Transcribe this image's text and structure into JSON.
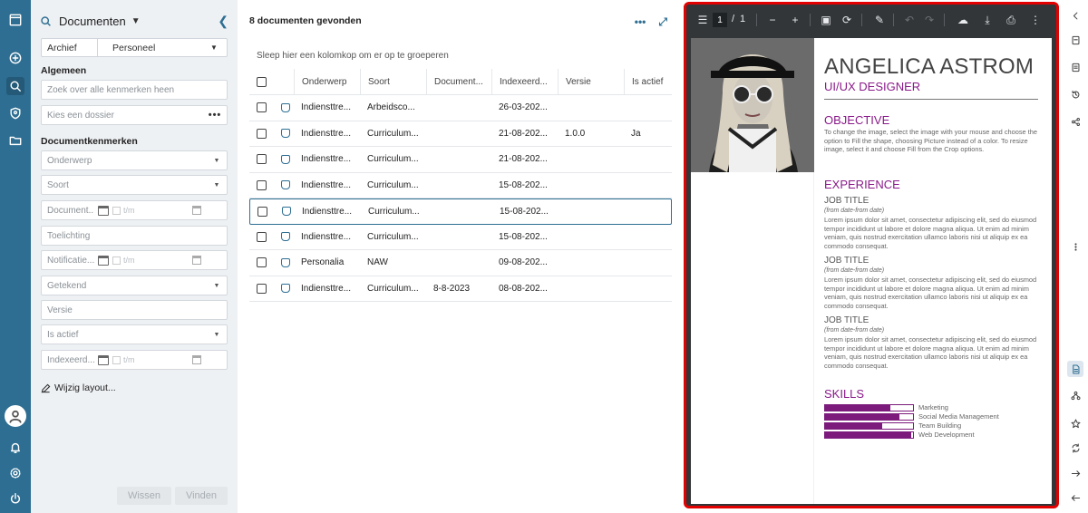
{
  "filters": {
    "title": "Documenten",
    "archive_label": "Archief",
    "archive_value": "Personeel",
    "section_general": "Algemeen",
    "search_placeholder": "Zoek over alle kenmerken heen",
    "dossier_placeholder": "Kies een dossier",
    "section_doc_props": "Documentkenmerken",
    "fields": {
      "onderwerp": "Onderwerp",
      "soort": "Soort",
      "document": "Document...",
      "toelichting": "Toelichting",
      "notificatie": "Notificatie...",
      "getekend": "Getekend",
      "versie": "Versie",
      "is_actief": "Is actief",
      "indexeerd": "Indexeerd..."
    },
    "tm_label": "t/m",
    "layout_link": "Wijzig layout...",
    "clear_button": "Wissen",
    "find_button": "Vinden"
  },
  "results": {
    "count_text": "8 documenten gevonden",
    "group_hint": "Sleep hier een kolomkop om er op te groeperen",
    "columns": [
      "Onderwerp",
      "Soort",
      "Document...",
      "Indexeerd...",
      "Versie",
      "Is actief"
    ],
    "rows": [
      {
        "onderwerp": "Indiensttre...",
        "soort": "Arbeidsco...",
        "document": "",
        "indexeerd": "26-03-202...",
        "versie": "",
        "actief": ""
      },
      {
        "onderwerp": "Indiensttre...",
        "soort": "Curriculum...",
        "document": "",
        "indexeerd": "21-08-202...",
        "versie": "1.0.0",
        "actief": "Ja"
      },
      {
        "onderwerp": "Indiensttre...",
        "soort": "Curriculum...",
        "document": "",
        "indexeerd": "21-08-202...",
        "versie": "",
        "actief": ""
      },
      {
        "onderwerp": "Indiensttre...",
        "soort": "Curriculum...",
        "document": "",
        "indexeerd": "15-08-202...",
        "versie": "",
        "actief": ""
      },
      {
        "onderwerp": "Indiensttre...",
        "soort": "Curriculum...",
        "document": "",
        "indexeerd": "15-08-202...",
        "versie": "",
        "actief": ""
      },
      {
        "onderwerp": "Indiensttre...",
        "soort": "Curriculum...",
        "document": "",
        "indexeerd": "15-08-202...",
        "versie": "",
        "actief": ""
      },
      {
        "onderwerp": "Personalia",
        "soort": "NAW",
        "document": "",
        "indexeerd": "09-08-202...",
        "versie": "",
        "actief": ""
      },
      {
        "onderwerp": "Indiensttre...",
        "soort": "Curriculum...",
        "document": "8-8-2023",
        "indexeerd": "08-08-202...",
        "versie": "",
        "actief": ""
      }
    ],
    "selected_row": 4
  },
  "viewer": {
    "page_current": "1",
    "page_sep": "/",
    "page_total": "1",
    "border_color": "#e20000"
  },
  "cv": {
    "name": "ANGELICA ASTROM",
    "role": "UI/UX DESIGNER",
    "objective_heading": "OBJECTIVE",
    "objective_text": "To change the image, select the image with your mouse and choose the option to Fill the shape, choosing Picture instead of a color.  To resize image, select it and choose Fill from the Crop options.",
    "experience_heading": "EXPERIENCE",
    "jobs": [
      {
        "title": "JOB TITLE",
        "dates": "(from date-from date)",
        "text": "Lorem ipsum dolor sit amet, consectetur adipiscing elit, sed do eiusmod tempor incididunt ut labore et dolore magna aliqua. Ut enim ad minim veniam, quis nostrud exercitation ullamco laboris nisi ut aliquip ex ea commodo consequat."
      },
      {
        "title": "JOB TITLE",
        "dates": "(from date-from date)",
        "text": "Lorem ipsum dolor sit amet, consectetur adipiscing elit, sed do eiusmod tempor incididunt ut labore et dolore magna aliqua. Ut enim ad minim veniam, quis nostrud exercitation ullamco laboris nisi ut aliquip ex ea commodo consequat."
      },
      {
        "title": "JOB TITLE",
        "dates": "(from date-from date)",
        "text": "Lorem ipsum dolor sit amet, consectetur adipiscing elit, sed do eiusmod tempor incididunt ut labore et dolore magna aliqua. Ut enim ad minim veniam, quis nostrud exercitation ullamco laboris nisi ut aliquip ex ea commodo consequat."
      }
    ],
    "skills_heading": "SKILLS",
    "skills": [
      {
        "label": "Marketing",
        "level": 0.74
      },
      {
        "label": "Social Media Management",
        "level": 0.85
      },
      {
        "label": "Team Building",
        "level": 0.65
      },
      {
        "label": "Web Development",
        "level": 0.98
      }
    ]
  },
  "colors": {
    "rail": "#2e6e92",
    "accent": "#8a1a8a",
    "highlight": "#e20000"
  }
}
